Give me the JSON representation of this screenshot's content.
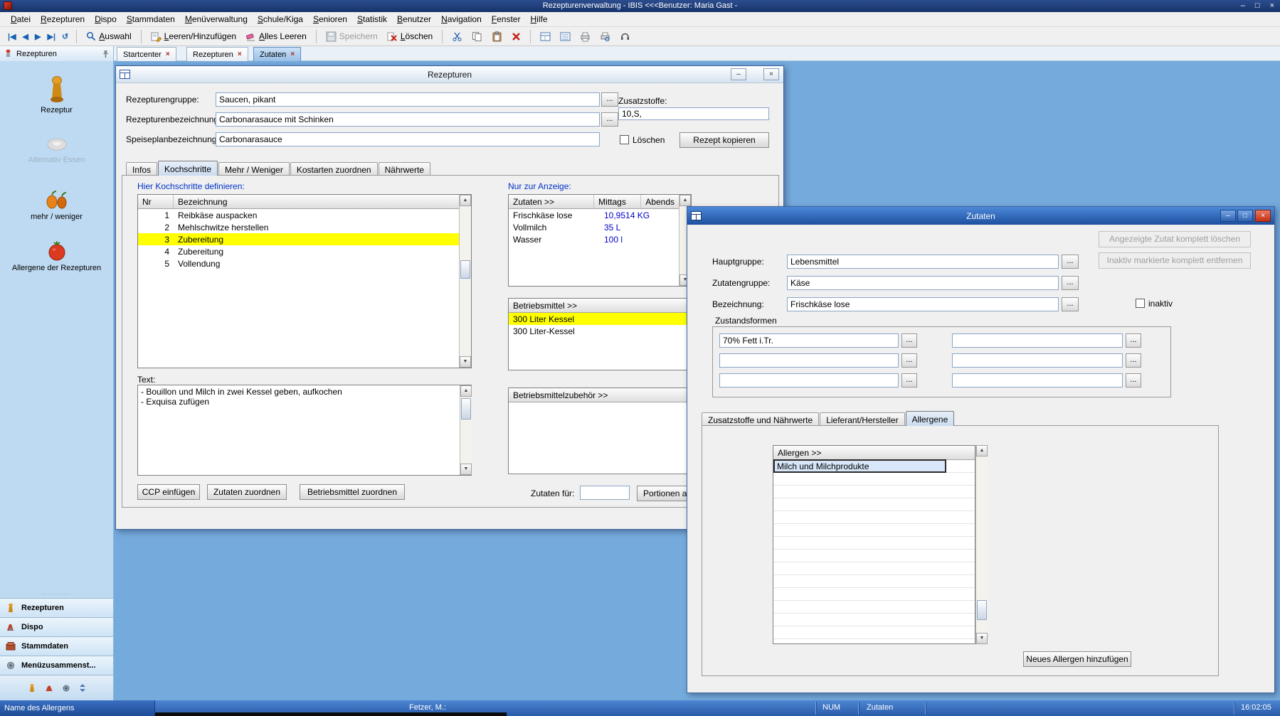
{
  "ui": {
    "minimize": "–",
    "maximize": "□",
    "close": "×",
    "ellipsis": "...",
    "up": "▲",
    "down": "▼",
    "tab_close": "×"
  },
  "window": {
    "title": "Rezepturenverwaltung - IBIS <<<Benutzer: Maria Gast -"
  },
  "menubar": {
    "items": [
      "Datei",
      "Rezepturen",
      "Dispo",
      "Stammdaten",
      "Menüverwaltung",
      "Schule/Kiga",
      "Senioren",
      "Statistik",
      "Benutzer",
      "Navigation",
      "Fenster",
      "Hilfe"
    ]
  },
  "toolbar": {
    "nav_first": "|◀",
    "nav_prev": "◀",
    "nav_next": "▶",
    "nav_last": "▶|",
    "undo": "↺",
    "auswahl": "Auswahl",
    "leeren_hinzufuegen": "Leeren/Hinzufügen",
    "alles_leeren": "Alles Leeren",
    "speichern": "Speichern",
    "loeschen": "Löschen"
  },
  "doc_tabs": {
    "tabs": [
      {
        "label": "Startcenter"
      },
      {
        "label": "Rezepturen"
      },
      {
        "label": "Zutaten"
      }
    ]
  },
  "sidebar": {
    "header": "Rezepturen",
    "items": [
      {
        "label": "Rezeptur"
      },
      {
        "label": "Alternativ Essen"
      },
      {
        "label": "mehr / weniger"
      },
      {
        "label": "Allergene der Rezepturen"
      }
    ],
    "stack": [
      {
        "label": "Rezepturen"
      },
      {
        "label": "Dispo"
      },
      {
        "label": "Stammdaten"
      },
      {
        "label": "Menüzusammenst..."
      }
    ]
  },
  "rezepturen": {
    "title": "Rezepturen",
    "rezepturengruppe_label": "Rezepturengruppe:",
    "rezepturengruppe_value": "Saucen, pikant",
    "rezepturenbezeichnung_label": "Rezepturenbezeichnung:",
    "rezepturenbezeichnung_value": "Carbonarasauce mit Schinken",
    "speiseplanbezeichnung_label": "Speiseplanbezeichnung:",
    "speiseplanbezeichnung_value": "Carbonarasauce",
    "zusatzstoffe_label": "Zusatzstoffe:",
    "zusatzstoffe_value": "10,S,",
    "loeschen_label": "Löschen",
    "rezept_kopieren": "Rezept kopieren",
    "tabs": [
      {
        "label": "Infos"
      },
      {
        "label": "Kochschritte"
      },
      {
        "label": "Mehr / Weniger"
      },
      {
        "label": "Kostarten zuordnen"
      },
      {
        "label": "Nährwerte"
      }
    ],
    "kochschritte_heading": "Hier Kochschritte definieren:",
    "steps": {
      "headers": {
        "nr": "Nr",
        "bezeichnung": "Bezeichnung"
      },
      "rows": [
        {
          "nr": "1",
          "bezeichnung": "Reibkäse auspacken"
        },
        {
          "nr": "2",
          "bezeichnung": "Mehlschwitze herstellen"
        },
        {
          "nr": "3",
          "bezeichnung": "Zubereitung"
        },
        {
          "nr": "4",
          "bezeichnung": "Zubereitung"
        },
        {
          "nr": "5",
          "bezeichnung": "Vollendung"
        }
      ]
    },
    "text_label": "Text:",
    "text_value": "- Bouillon und Milch in zwei Kessel geben, aufkochen\n- Exquisa zufügen",
    "ccp_button": "CCP einfügen",
    "zutaten_zuordnen_button": "Zutaten zuordnen",
    "betriebsmittel_zuordnen_button": "Betriebsmittel zuordnen",
    "anzeige_heading": "Nur zur Anzeige:",
    "zutaten_table": {
      "headers": {
        "zutaten": "Zutaten >>",
        "mittags": "Mittags",
        "abends": "Abends"
      },
      "rows": [
        {
          "name": "Frischkäse lose",
          "mittags": "10,9514 KG"
        },
        {
          "name": "Vollmilch",
          "mittags": "35 L"
        },
        {
          "name": "Wasser",
          "mittags": "100 l"
        }
      ]
    },
    "betriebsmittel_table": {
      "header": "Betriebsmittel >>",
      "rows": [
        {
          "name": "300 Liter Kessel"
        },
        {
          "name": "300 Liter-Kessel"
        }
      ]
    },
    "zubehoer_table": {
      "header": "Betriebsmittelzubehör >>"
    },
    "zutaten_fuer_label": "Zutaten für:",
    "portionen_button": "Portionen a"
  },
  "zutaten": {
    "title": "Zutaten",
    "delete_zutat_button": "Angezeigte Zutat komplett löschen",
    "remove_inactive_button": "Inaktiv markierte komplett entfernen",
    "hauptgruppe_label": "Hauptgruppe:",
    "hauptgruppe_value": "Lebensmittel",
    "zutatengruppe_label": "Zutatengruppe:",
    "zutatengruppe_value": "Käse",
    "bezeichnung_label": "Bezeichnung:",
    "bezeichnung_value": "Frischkäse lose",
    "inaktiv_label": "inaktiv",
    "zustandsformen_label": "Zustandsformen",
    "zustandsform_1": "70% Fett i.Tr.",
    "tabs": [
      {
        "label": "Zusatzstoffe und Nährwerte"
      },
      {
        "label": "Lieferant/Hersteller"
      },
      {
        "label": "Allergene"
      }
    ],
    "allergen_table": {
      "header": "Allergen >>",
      "rows": [
        {
          "name": "Milch und Milchprodukte"
        }
      ]
    },
    "neues_allergen_button": "Neues Allergen hinzufügen"
  },
  "statusbar": {
    "left": "Name des Allergens",
    "user": "Fetzer, M.:",
    "num": "NUM",
    "context": "Zutaten",
    "time": "16:02:05"
  }
}
